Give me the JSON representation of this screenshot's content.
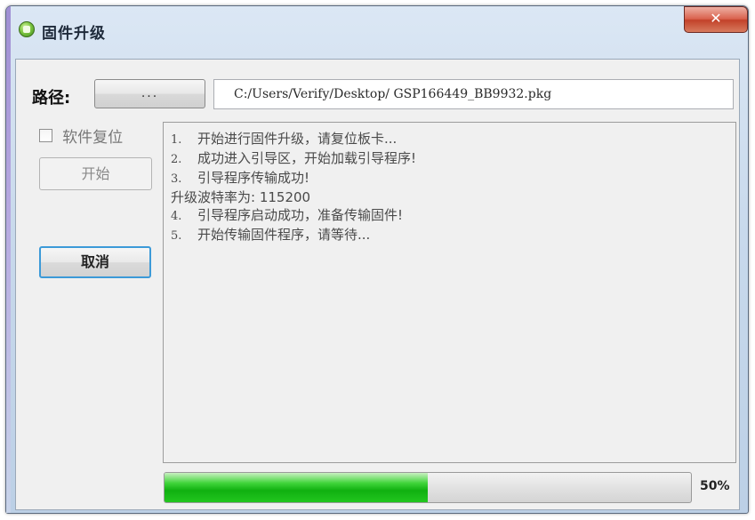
{
  "window": {
    "title": "固件升级",
    "close_symbol": "✕"
  },
  "path": {
    "label": "路径:",
    "browse_label": "...",
    "value": "C:/Users/Verify/Desktop/ GSP166449_BB9932.pkg"
  },
  "options": {
    "soft_reset_label": "软件复位",
    "soft_reset_checked": false
  },
  "buttons": {
    "start_label": "开始",
    "cancel_label": "取消"
  },
  "log": {
    "lines": [
      {
        "num": "1.",
        "text": "开始进行固件升级，请复位板卡..."
      },
      {
        "num": "2.",
        "text": "成功进入引导区，开始加载引导程序!"
      },
      {
        "num": "3.",
        "text": "引导程序传输成功!"
      },
      {
        "num": "",
        "text": "升级波特率为: 115200"
      },
      {
        "num": "4.",
        "text": "引导程序启动成功，准备传输固件!"
      },
      {
        "num": "5.",
        "text": "开始传输固件程序，请等待..."
      }
    ]
  },
  "progress": {
    "value": 0.5,
    "label": "50%"
  },
  "colors": {
    "progress_fill": "#22c61f",
    "focus_border": "#3c9ad8",
    "close_button": "#c24129"
  },
  "icons": {
    "app": "app-status-icon",
    "close": "close-icon"
  }
}
